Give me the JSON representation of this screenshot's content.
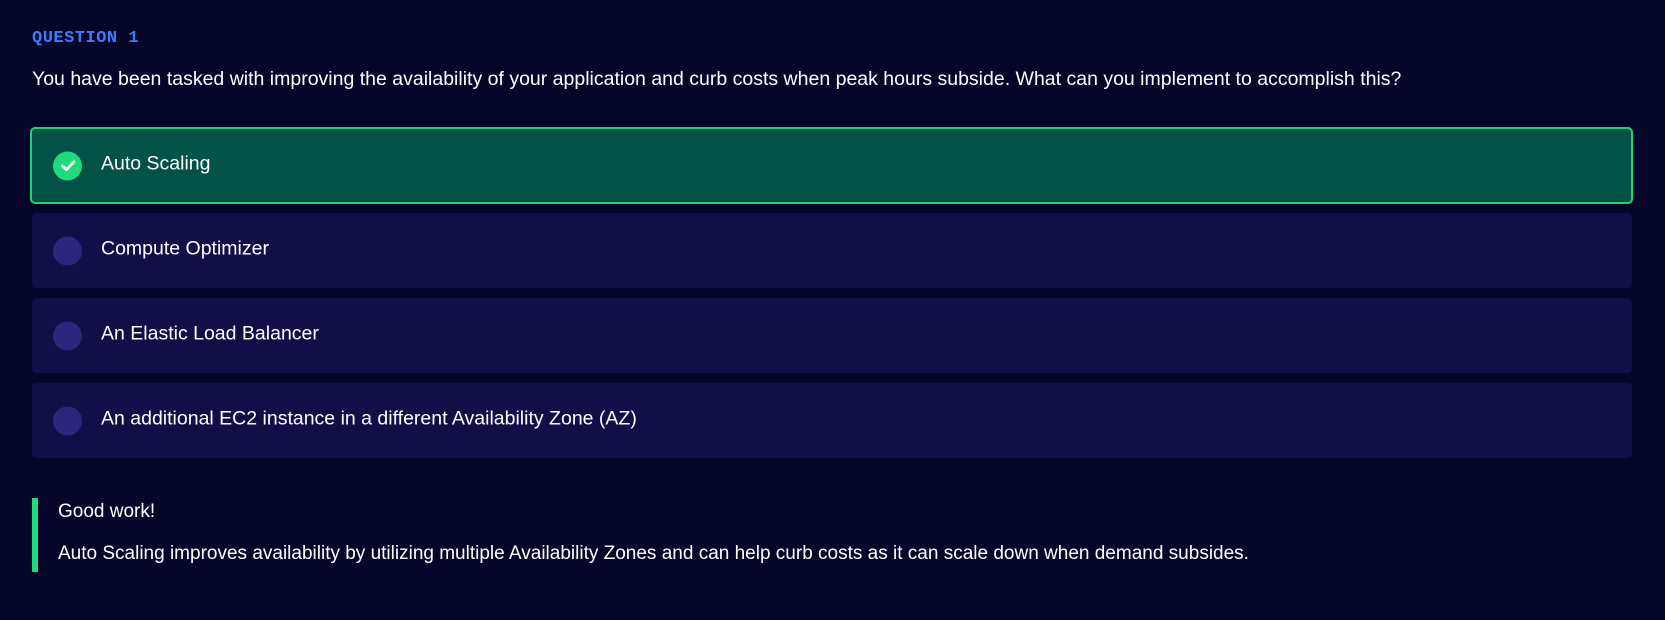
{
  "question": {
    "label": "QUESTION 1",
    "text": "You have been tasked with improving the availability of your application and curb costs when peak hours subside. What can you implement to accomplish this?"
  },
  "options": [
    {
      "label": "Auto Scaling",
      "selected": true,
      "correct": true
    },
    {
      "label": "Compute Optimizer",
      "selected": false
    },
    {
      "label": "An Elastic Load Balancer",
      "selected": false
    },
    {
      "label": "An additional EC2 instance in a different Availability Zone (AZ)",
      "selected": false
    }
  ],
  "feedback": {
    "title": "Good work!",
    "text": "Auto Scaling improves availability by utilizing multiple Availability Zones and can help curb costs as it can scale down when demand subsides."
  },
  "colors": {
    "background": "#05052a",
    "accent_blue": "#3a7bff",
    "correct_green": "#1edb7c",
    "selected_bg": "#035246",
    "option_bg": "#110e48",
    "radio_bg": "#2b277d"
  },
  "icons": {
    "selected_option": "check-circle-icon",
    "unselected_option": "radio-circle-icon"
  }
}
